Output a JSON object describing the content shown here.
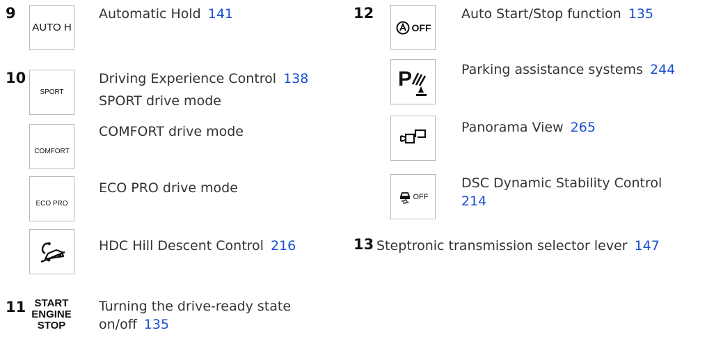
{
  "left": {
    "item9": {
      "number": "9",
      "icon_label": "AUTO H",
      "text": "Automatic Hold",
      "page": "141"
    },
    "item10": {
      "number": "10",
      "sport": {
        "icon_label": "SPORT",
        "line1": "Driving Experience Control",
        "page": "138",
        "line2": "SPORT drive mode"
      },
      "comfort": {
        "icon_label": "COMFORT",
        "text": "COMFORT drive mode"
      },
      "eco": {
        "icon_label": "ECO PRO",
        "text": "ECO PRO drive mode"
      },
      "hdc": {
        "icon": "hill-descent-car-icon",
        "text": "HDC Hill Descent Control",
        "page": "216"
      }
    },
    "item11": {
      "number": "11",
      "icon_lines": [
        "START",
        "ENGINE",
        "STOP"
      ],
      "line1": "Turning the drive-ready state",
      "line2": "on/off",
      "page": "135"
    }
  },
  "right": {
    "item12": {
      "number": "12",
      "autostart": {
        "icon_label": "OFF",
        "icon": "auto-start-stop-icon",
        "text": "Auto Start/Stop function",
        "page": "135"
      },
      "parking": {
        "icon": "parking-assistance-icon",
        "text": "Parking assistance systems",
        "page": "244"
      },
      "panorama": {
        "icon": "panorama-view-icon",
        "text": "Panorama View",
        "page": "265"
      },
      "dsc": {
        "icon": "dsc-off-icon",
        "icon_label": "OFF",
        "line1": "DSC Dynamic Stability Control",
        "page": "214"
      }
    },
    "item13": {
      "number": "13",
      "text": "Steptronic transmission selector lever",
      "page": "147"
    }
  },
  "colors": {
    "link": "#1b4fd1",
    "text": "#333333",
    "border": "#b9b9b9"
  }
}
